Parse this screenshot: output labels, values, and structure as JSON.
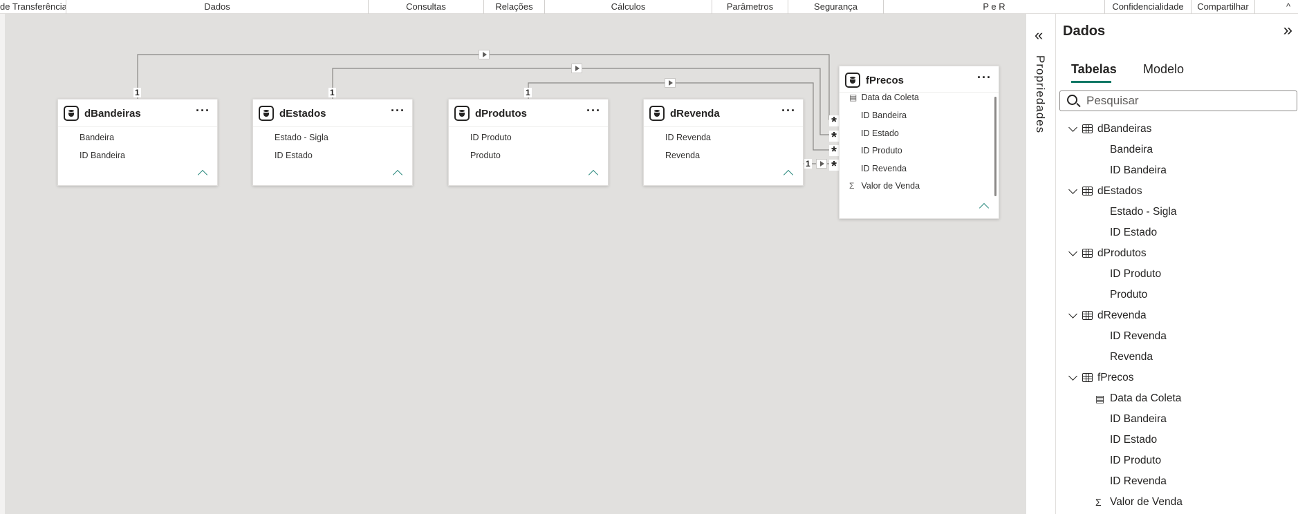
{
  "ribbon": {
    "groups": [
      {
        "label": "de Transferência"
      },
      {
        "label": "Dados"
      },
      {
        "label": "Consultas"
      },
      {
        "label": "Relações"
      },
      {
        "label": "Cálculos"
      },
      {
        "label": "Parâmetros"
      },
      {
        "label": "Segurança"
      },
      {
        "label": "P e R"
      },
      {
        "label": "Confidencialidade"
      },
      {
        "label": "Compartilhar"
      }
    ],
    "collapse_glyph": "^"
  },
  "model": {
    "tables": [
      {
        "name": "dBandeiras",
        "fields": [
          "Bandeira",
          "ID Bandeira"
        ]
      },
      {
        "name": "dEstados",
        "fields": [
          "Estado - Sigla",
          "ID Estado"
        ]
      },
      {
        "name": "dProdutos",
        "fields": [
          "ID Produto",
          "Produto"
        ]
      },
      {
        "name": "dRevenda",
        "fields": [
          "ID Revenda",
          "Revenda"
        ]
      },
      {
        "name": "fPrecos",
        "fields": [
          "Data da Coleta",
          "ID Bandeira",
          "ID Estado",
          "ID Produto",
          "ID Revenda",
          "Valor de Venda"
        ]
      }
    ],
    "more_glyph": "···",
    "one_label": "1",
    "many_label": "*"
  },
  "properties_pane": {
    "label": "Propriedades",
    "expand_glyph": "«"
  },
  "data_pane": {
    "title": "Dados",
    "collapse_glyph": "»",
    "tabs": [
      {
        "label": "Tabelas",
        "active": true
      },
      {
        "label": "Modelo",
        "active": false
      }
    ],
    "search_placeholder": "Pesquisar",
    "tree": [
      {
        "name": "dBandeiras",
        "fields": [
          {
            "label": "Bandeira"
          },
          {
            "label": "ID Bandeira"
          }
        ]
      },
      {
        "name": "dEstados",
        "fields": [
          {
            "label": "Estado - Sigla"
          },
          {
            "label": "ID Estado"
          }
        ]
      },
      {
        "name": "dProdutos",
        "fields": [
          {
            "label": "ID Produto"
          },
          {
            "label": "Produto"
          }
        ]
      },
      {
        "name": "dRevenda",
        "fields": [
          {
            "label": "ID Revenda"
          },
          {
            "label": "Revenda"
          }
        ]
      },
      {
        "name": "fPrecos",
        "fields": [
          {
            "label": "Data da Coleta",
            "icon": "calendar-icon"
          },
          {
            "label": "ID Bandeira"
          },
          {
            "label": "ID Estado"
          },
          {
            "label": "ID Produto"
          },
          {
            "label": "ID Revenda"
          },
          {
            "label": "Valor de Venda",
            "icon": "sigma-icon"
          }
        ]
      }
    ]
  }
}
